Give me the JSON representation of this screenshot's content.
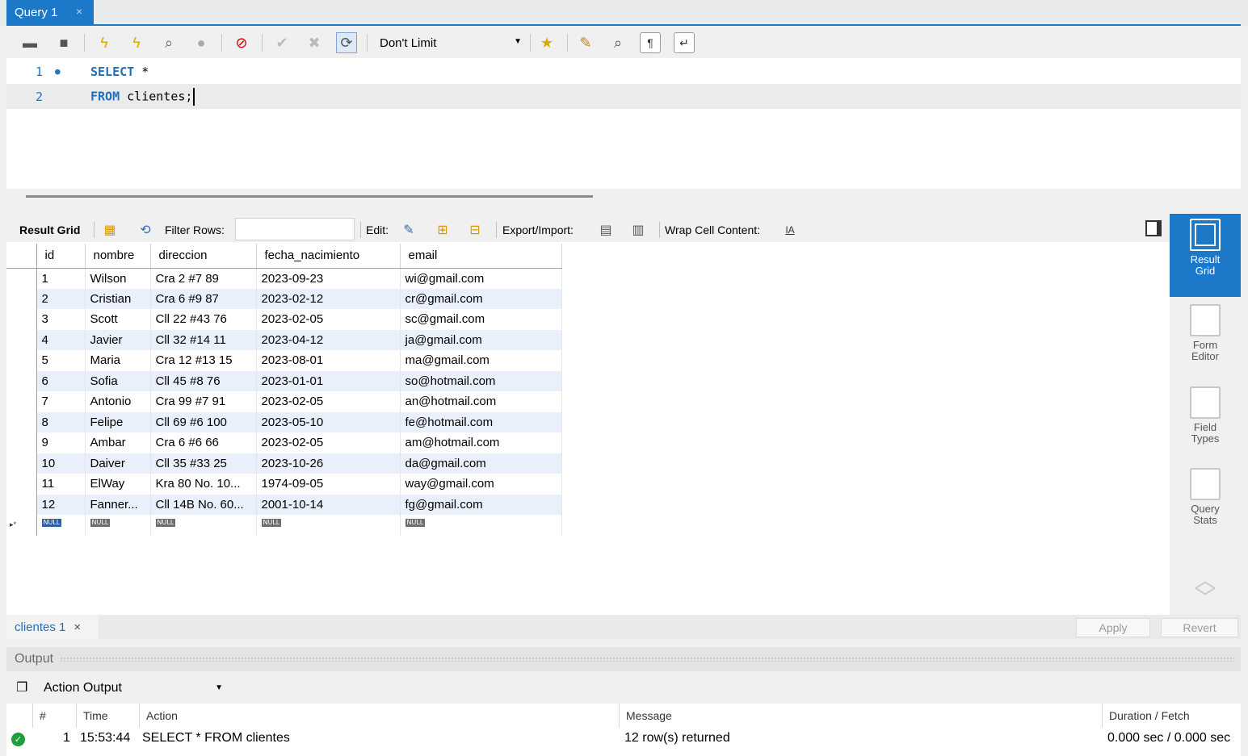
{
  "query_tab": {
    "title": "Query 1",
    "close": "×"
  },
  "toolbar": {
    "limit_select": "Don't Limit"
  },
  "editor": {
    "lines": [
      {
        "number": "1",
        "keyword": "SELECT",
        "rest": " *"
      },
      {
        "number": "2",
        "keyword": "FROM",
        "rest": " clientes;"
      }
    ]
  },
  "result_toolbar": {
    "result_grid_label": "Result Grid",
    "filter_rows_label": "Filter Rows:",
    "filter_value": "",
    "edit_label": "Edit:",
    "export_import_label": "Export/Import:",
    "wrap_label": "Wrap Cell Content:"
  },
  "grid": {
    "columns": [
      "id",
      "nombre",
      "direccion",
      "fecha_nacimiento",
      "email"
    ],
    "rows": [
      [
        "1",
        "Wilson",
        "Cra 2 #7 89",
        "2023-09-23",
        "wi@gmail.com"
      ],
      [
        "2",
        "Cristian",
        "Cra 6 #9 87",
        "2023-02-12",
        "cr@gmail.com"
      ],
      [
        "3",
        "Scott",
        "Cll 22 #43 76",
        "2023-02-05",
        "sc@gmail.com"
      ],
      [
        "4",
        "Javier",
        "Cll 32 #14 11",
        "2023-04-12",
        "ja@gmail.com"
      ],
      [
        "5",
        "Maria",
        "Cra 12 #13 15",
        "2023-08-01",
        "ma@gmail.com"
      ],
      [
        "6",
        "Sofia",
        "Cll 45 #8 76",
        "2023-01-01",
        "so@hotmail.com"
      ],
      [
        "7",
        "Antonio",
        "Cra 99 #7 91",
        "2023-02-05",
        "an@hotmail.com"
      ],
      [
        "8",
        "Felipe",
        "Cll 69 #6 100",
        "2023-05-10",
        "fe@hotmail.com"
      ],
      [
        "9",
        "Ambar",
        "Cra 6 #6 66",
        "2023-02-05",
        "am@hotmail.com"
      ],
      [
        "10",
        "Daiver",
        "Cll 35 #33 25",
        "2023-10-26",
        "da@gmail.com"
      ],
      [
        "11",
        "ElWay",
        "Kra 80 No. 10...",
        "1974-09-05",
        "way@gmail.com"
      ],
      [
        "12",
        "Fanner...",
        "Cll 14B No. 60...",
        "2001-10-14",
        "fg@gmail.com"
      ]
    ],
    "null_label": "NULL",
    "new_row_marker": "▸*"
  },
  "sidebar": {
    "items": [
      {
        "label1": "Result",
        "label2": "Grid"
      },
      {
        "label1": "Form",
        "label2": "Editor"
      },
      {
        "label1": "Field",
        "label2": "Types"
      },
      {
        "label1": "Query",
        "label2": "Stats"
      }
    ]
  },
  "result_tab": {
    "label": "clientes 1",
    "close": "×"
  },
  "buttons": {
    "apply": "Apply",
    "revert": "Revert"
  },
  "output": {
    "header": "Output",
    "selector": "Action Output",
    "columns": {
      "num": "#",
      "time": "Time",
      "action": "Action",
      "message": "Message",
      "duration": "Duration / Fetch"
    },
    "row": {
      "num": "1",
      "time": "15:53:44",
      "action": "SELECT * FROM clientes",
      "message": "12 row(s) returned",
      "duration": "0.000 sec / 0.000 sec"
    }
  }
}
